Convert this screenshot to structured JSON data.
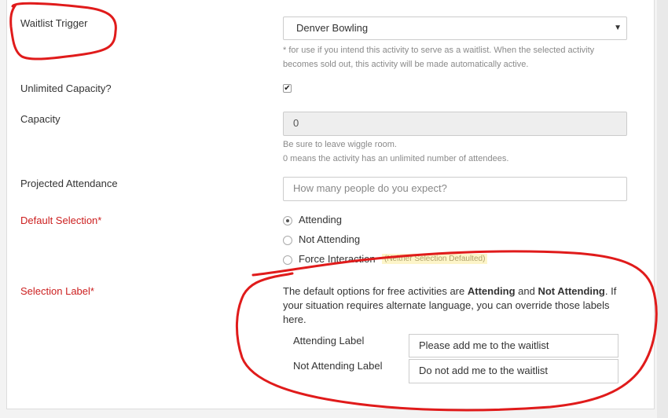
{
  "waitlist_trigger": {
    "label": "Waitlist Trigger",
    "selected": "Denver Bowling",
    "help": "* for use if you intend this activity to serve as a waitlist. When the selected activity becomes sold out, this activity will be made automatically active."
  },
  "unlimited_capacity": {
    "label": "Unlimited Capacity?",
    "checked": true
  },
  "capacity": {
    "label": "Capacity",
    "value": "0",
    "help_line1": "Be sure to leave wiggle room.",
    "help_line2": "0 means the activity has an unlimited number of attendees."
  },
  "projected_attendance": {
    "label": "Projected Attendance",
    "placeholder": "How many people do you expect?"
  },
  "default_selection": {
    "label": "Default Selection*",
    "options": [
      {
        "label": "Attending",
        "selected": true
      },
      {
        "label": "Not Attending",
        "selected": false
      },
      {
        "label": "Force Interaction",
        "selected": false,
        "badge": "(Neither Selection Defaulted)"
      }
    ]
  },
  "selection_label": {
    "label": "Selection Label*",
    "desc_part1": "The default options for free activities are ",
    "desc_bold1": "Attending",
    "desc_part2": " and ",
    "desc_bold2": "Not Attending",
    "desc_part3": ". If your situation requires alternate language, you can override those labels here.",
    "attending_label": "Attending Label",
    "attending_value": "Please add me to the waitlist",
    "not_attending_label": "Not Attending Label",
    "not_attending_value": "Do not add me to the waitlist"
  },
  "colors": {
    "required": "#cc1f1f",
    "annotation": "#e01b1b"
  },
  "icons": {
    "select_caret": "caret-down-icon",
    "checkbox_check": "check-icon"
  }
}
